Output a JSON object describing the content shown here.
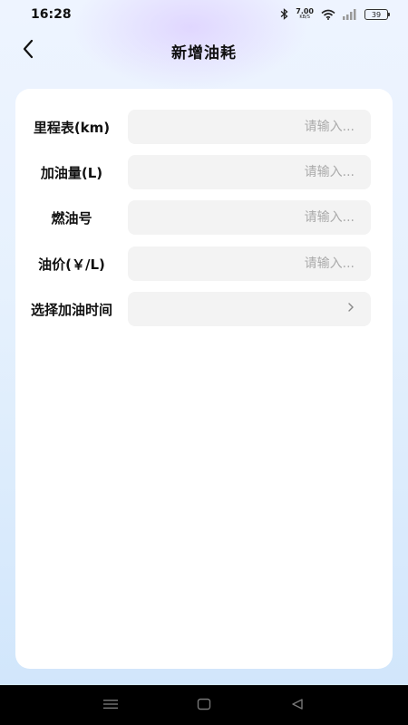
{
  "status_bar": {
    "time": "16:28",
    "net_speed": "7.00",
    "net_unit": "KB/S",
    "battery": "39"
  },
  "header": {
    "title": "新增油耗"
  },
  "form": {
    "mileage": {
      "label": "里程表(km)",
      "placeholder": "请输入..."
    },
    "fuel_amount": {
      "label": "加油量(L)",
      "placeholder": "请输入..."
    },
    "fuel_grade": {
      "label": "燃油号",
      "placeholder": "请输入..."
    },
    "fuel_price": {
      "label": "油价(￥/L)",
      "placeholder": "请输入..."
    },
    "refuel_time": {
      "label": "选择加油时间",
      "value": ""
    }
  },
  "icons": {
    "back": "chevron-left-icon",
    "select_arrow": "chevron-right-icon",
    "bluetooth": "bluetooth-icon",
    "wifi": "wifi-icon",
    "signal": "signal-icon",
    "nav_menu": "menu-icon",
    "nav_home": "home-icon",
    "nav_back": "triangle-back-icon"
  }
}
